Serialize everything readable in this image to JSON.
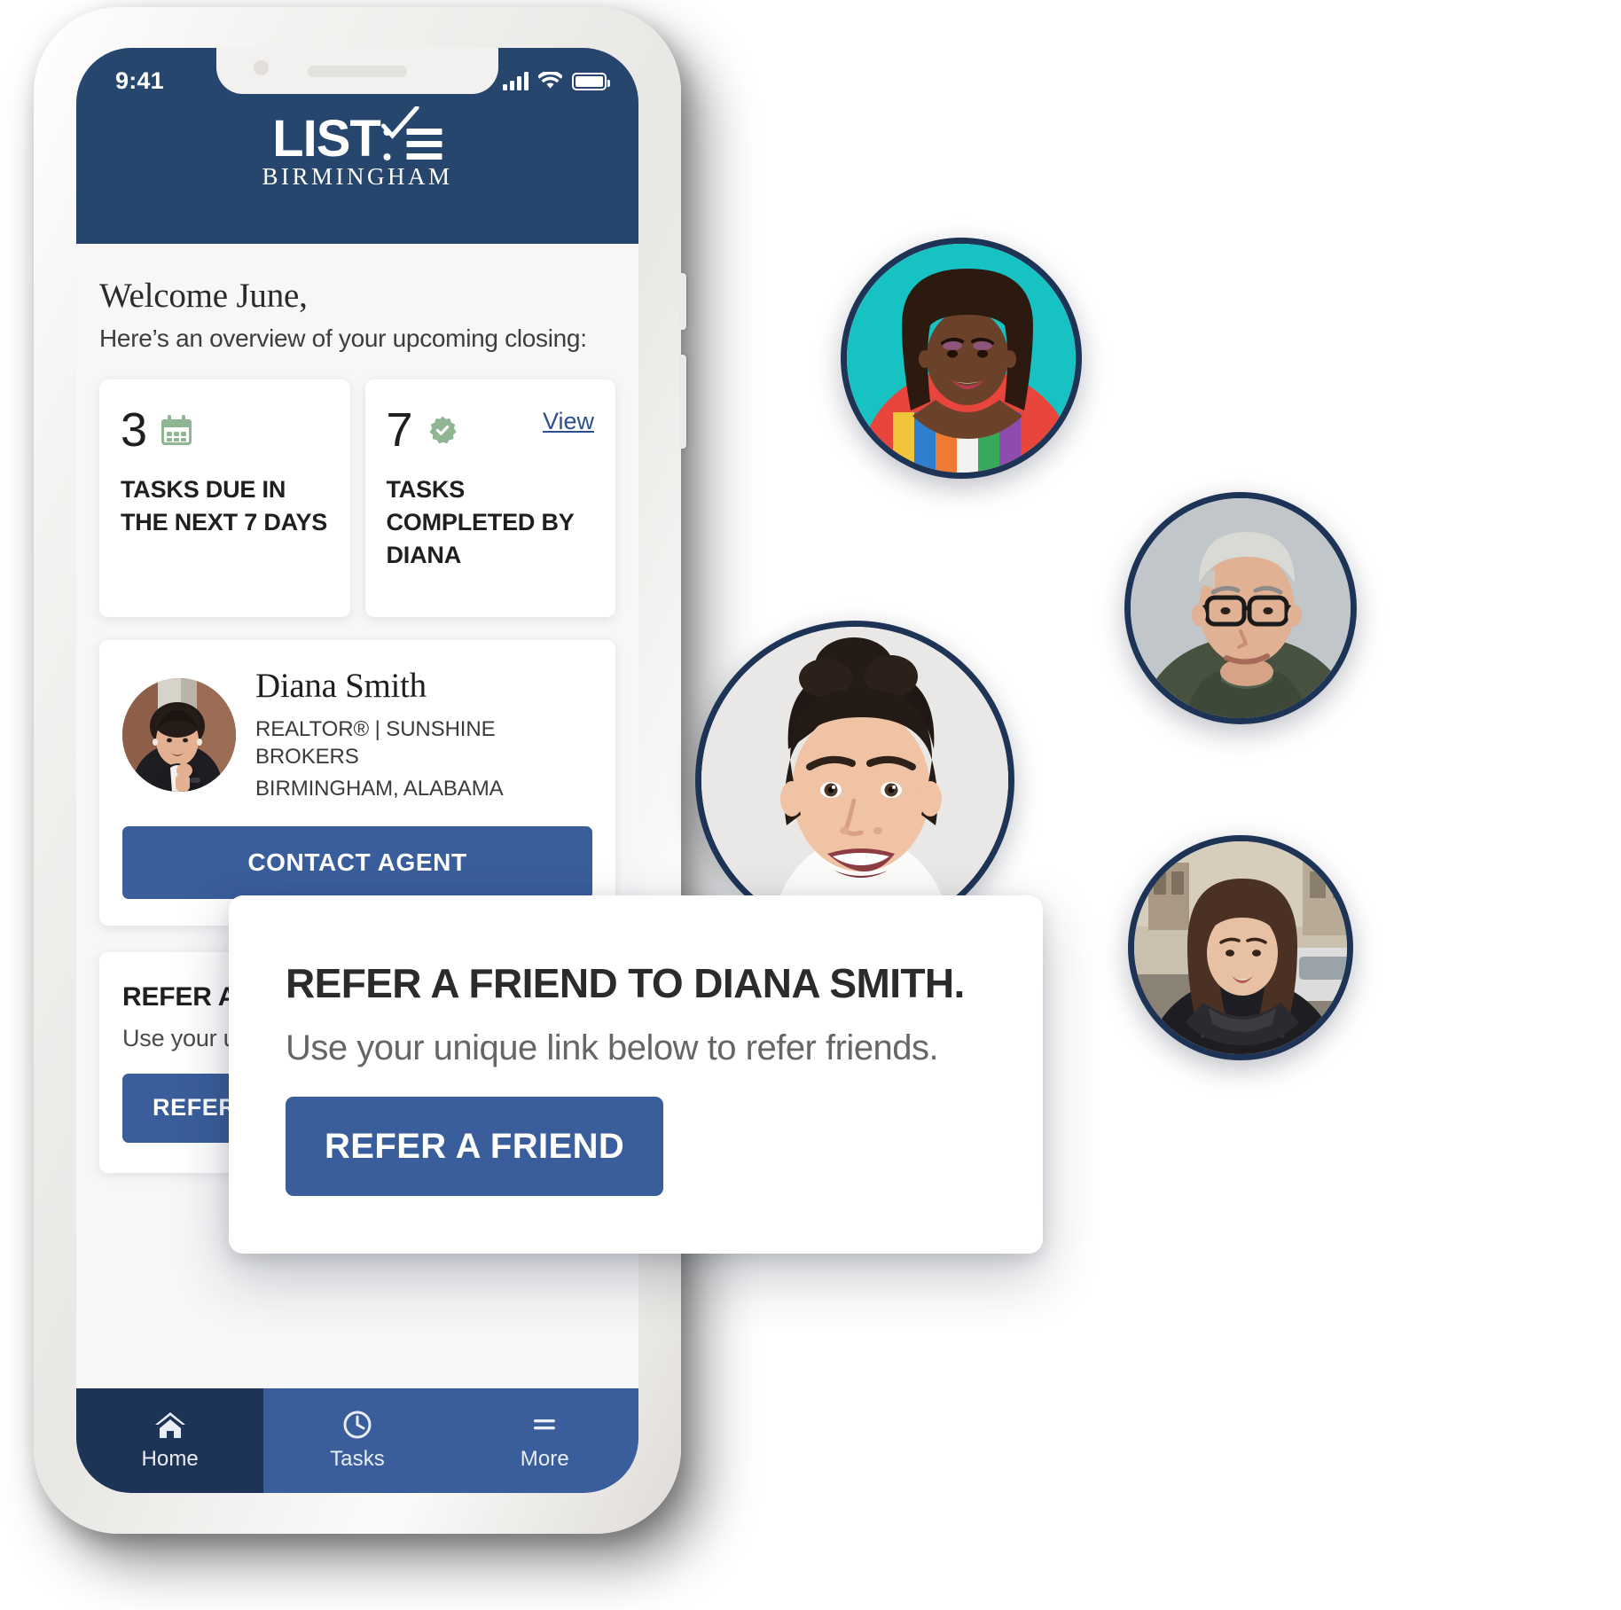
{
  "phone": {
    "status_bar": {
      "time": "9:41",
      "signal_icon": "cellular-signal-icon",
      "wifi_icon": "wifi-icon",
      "battery_icon": "battery-full-icon"
    },
    "header": {
      "logo_word": "LIST",
      "logo_sub": "BIRMINGHAM",
      "logo_mark": "checklist-check-icon",
      "bg_color": "#26466e"
    },
    "welcome": {
      "title": "Welcome June,",
      "subtitle": "Here’s an overview of your upcoming closing:"
    },
    "stat_cards": [
      {
        "value": "3",
        "icon": "calendar-icon",
        "label": "TASKS DUE IN THE NEXT 7 DAYS",
        "link": null
      },
      {
        "value": "7",
        "icon": "verified-check-badge-icon",
        "label": "TASKS COMPLETED BY DIANA",
        "link": "View"
      }
    ],
    "agent_card": {
      "name": "Diana Smith",
      "title_line": "REALTOR® | SUNSHINE BROKERS",
      "location_line": "BIRMINGHAM, ALABAMA",
      "photo_alt": "agent-headshot",
      "button_label": "CONTACT AGENT"
    },
    "refer_card_inline": {
      "title": "REFER A FRIEND TO DIANA SMITH.",
      "subtitle": "Use your unique link below to refer friends.",
      "button_label": "REFER A FRIEND"
    },
    "bottom_nav": {
      "items": [
        {
          "label": "Home",
          "icon": "home-icon",
          "active": true
        },
        {
          "label": "Tasks",
          "icon": "clock-icon",
          "active": false
        },
        {
          "label": "More",
          "icon": "menu-icon",
          "active": false
        }
      ]
    }
  },
  "refer_overlay": {
    "title": "REFER A FRIEND TO DIANA SMITH.",
    "subtitle": "Use your unique link below to refer friends.",
    "button_label": "REFER A FRIEND"
  },
  "network": {
    "nodes": [
      {
        "id": "agent-center",
        "alt": "center-agent-avatar"
      },
      {
        "id": "contact-one",
        "alt": "contact-avatar-woman-braids"
      },
      {
        "id": "contact-two",
        "alt": "contact-avatar-man-glasses"
      },
      {
        "id": "contact-three",
        "alt": "contact-avatar-woman-street"
      }
    ],
    "link_style": "dashed",
    "link_color": "#ffffff"
  },
  "colors": {
    "brand_navy": "#26466e",
    "brand_blue": "#3a5e9b",
    "nav_active": "#1e3456",
    "accent_green": "#8fb592",
    "link_blue": "#2b4f8f",
    "page_bg": "#f7f7f8"
  }
}
